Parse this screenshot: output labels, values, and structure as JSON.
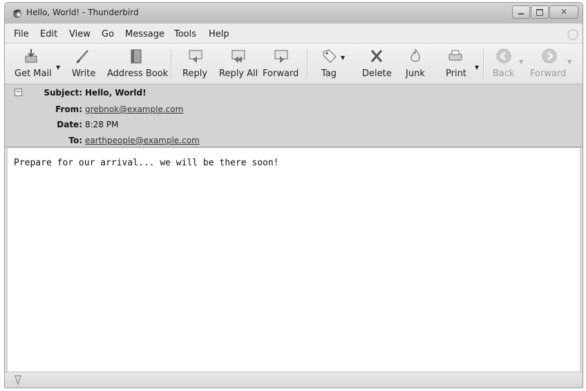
{
  "window": {
    "title": "Hello, World! - Thunderbird"
  },
  "menu": [
    "File",
    "Edit",
    "View",
    "Go",
    "Message",
    "Tools",
    "Help"
  ],
  "toolbar": {
    "get_mail": "Get Mail",
    "write": "Write",
    "address_book": "Address Book",
    "reply": "Reply",
    "reply_all": "Reply All",
    "forward": "Forward",
    "tag": "Tag",
    "delete": "Delete",
    "junk": "Junk",
    "print": "Print",
    "back": "Back",
    "forward_nav": "Forward"
  },
  "headers": {
    "subject_label": "Subject:",
    "subject": "Hello, World!",
    "from_label": "From:",
    "from": "grebnok@example.com",
    "date_label": "Date:",
    "date": "8:28 PM",
    "to_label": "To:",
    "to": "earthpeople@example.com"
  },
  "message": {
    "body": "Prepare for our arrival... we will be there soon!"
  },
  "icons": {
    "app": "thunderbird-icon",
    "status": "status-icon"
  }
}
